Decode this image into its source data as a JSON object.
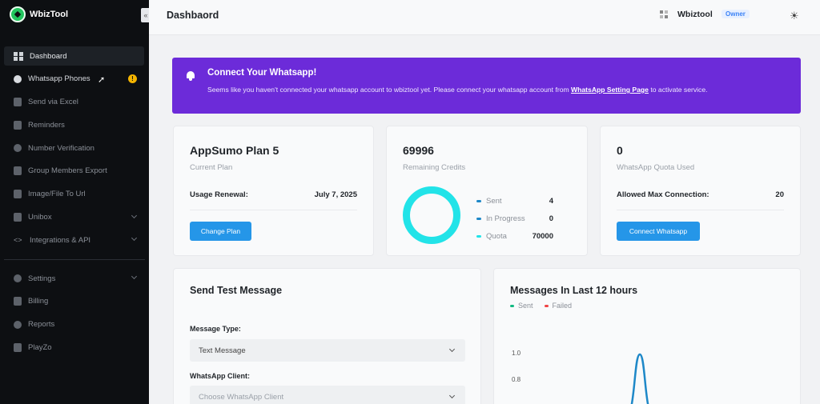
{
  "app": {
    "name": "WbizTool",
    "collapse_icon": "«"
  },
  "sidebar": {
    "items": [
      {
        "label": "Dashboard",
        "icon": "dashboard-icon"
      },
      {
        "label": "Whatsapp Phones",
        "icon": "phone-icon",
        "badge": "!"
      },
      {
        "label": "Send via Excel",
        "icon": "excel-icon"
      },
      {
        "label": "Reminders",
        "icon": "reminder-icon"
      },
      {
        "label": "Number Verification",
        "icon": "verify-icon"
      },
      {
        "label": "Group Members Export",
        "icon": "export-icon"
      },
      {
        "label": "Image/File To Url",
        "icon": "image-icon"
      },
      {
        "label": "Unibox",
        "icon": "inbox-icon"
      },
      {
        "label": "Integrations & API",
        "icon": "code-icon"
      }
    ],
    "secondary_items": [
      {
        "label": "Settings",
        "icon": "gear-icon"
      },
      {
        "label": "Billing",
        "icon": "billing-icon"
      },
      {
        "label": "Reports",
        "icon": "reports-icon"
      },
      {
        "label": "PlayZo",
        "icon": "playzo-icon"
      }
    ]
  },
  "header": {
    "title": "Dashbaord",
    "user": "Wbiztool",
    "role_badge": "Owner",
    "theme_icon": "☀"
  },
  "banner": {
    "title": "Connect Your Whatsapp!",
    "message_before": "Seems like you haven't connected your whatsapp account to wbiztool yet. Please connect your whatsapp account from ",
    "link_text": "WhatsApp Setting Page",
    "message_after": " to activate service."
  },
  "plan_card": {
    "title": "AppSumo Plan 5",
    "subtitle": "Current Plan",
    "renewal_label": "Usage Renewal:",
    "renewal_value": "July 7, 2025",
    "button": "Change Plan"
  },
  "credits_card": {
    "value": "69996",
    "subtitle": "Remaining Credits",
    "legend": [
      {
        "label": "Sent",
        "value": "4",
        "color": "#1e88c8"
      },
      {
        "label": "In Progress",
        "value": "0",
        "color": "#1e88c8"
      },
      {
        "label": "Quota",
        "value": "70000",
        "color": "#22e3e8"
      }
    ]
  },
  "quota_card": {
    "value": "0",
    "subtitle": "WhatsApp Quota Used",
    "max_label": "Allowed Max Connection:",
    "max_value": "20",
    "button": "Connect Whatsapp"
  },
  "test_message": {
    "title": "Send Test Message",
    "type_label": "Message Type:",
    "type_value": "Text Message",
    "client_label": "WhatsApp Client:",
    "client_placeholder": "Choose WhatsApp Client"
  },
  "chart_data": {
    "type": "line",
    "title": "Messages In Last 12 hours",
    "series": [
      {
        "name": "Sent",
        "color": "#10b981"
      },
      {
        "name": "Failed",
        "color": "#ef4444"
      }
    ],
    "y_ticks": [
      "1.0",
      "0.8"
    ],
    "peak_value": 1.0
  }
}
